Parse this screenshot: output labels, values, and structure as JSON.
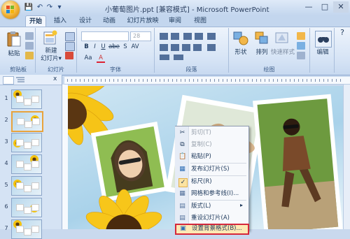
{
  "window": {
    "title": "小葡萄图片.ppt [兼容模式] - Microsoft PowerPoint",
    "controls": {
      "minimize": "—",
      "maximize": "□",
      "close": "✕"
    }
  },
  "qat": {
    "save": "💾",
    "undo": "↶",
    "redo": "↷",
    "more": "▾"
  },
  "tabs": [
    "开始",
    "插入",
    "设计",
    "动画",
    "幻灯片放映",
    "审阅",
    "视图"
  ],
  "ribbon": {
    "clipboard": {
      "label": "剪贴板",
      "paste": "粘贴"
    },
    "slides": {
      "label": "幻灯片",
      "new_slide_line1": "新建",
      "new_slide_line2": "幻灯片▾"
    },
    "font": {
      "label": "字体",
      "size_value": "28",
      "bold": "B",
      "italic": "I",
      "underline": "U",
      "strike": "abe",
      "shadow": "S",
      "spacing": "AV",
      "case": "Aa",
      "color": "A"
    },
    "paragraph": {
      "label": "段落"
    },
    "drawing": {
      "label": "绘图",
      "shape": "形状",
      "arrange": "排列",
      "quick_style": "快速样式"
    },
    "editing": {
      "label": "",
      "edit": "编辑"
    }
  },
  "slides_panel": {
    "numbers": [
      "1",
      "2",
      "3",
      "4",
      "5",
      "6",
      "7"
    ],
    "selected_index": 1,
    "close": "x"
  },
  "context_menu": {
    "items": [
      {
        "label": "剪切(T)",
        "icon": "✂",
        "disabled": true
      },
      {
        "label": "复制(C)",
        "icon": "⧉",
        "disabled": true
      },
      {
        "label": "粘贴(P)",
        "icon": "📋",
        "disabled": false
      },
      {
        "label": "发布幻灯片(S)",
        "icon": "▦",
        "disabled": false
      },
      {
        "label": "标尺(R)",
        "icon": "✓",
        "disabled": false
      },
      {
        "label": "网格和参考线(I)...",
        "icon": "▦",
        "disabled": false
      },
      {
        "label": "版式(L)",
        "icon": "▤",
        "disabled": false,
        "submenu": "▸"
      },
      {
        "label": "重设幻灯片(A)",
        "icon": "▤",
        "disabled": false
      },
      {
        "label": "设置背景格式(B)...",
        "icon": "▣",
        "disabled": false,
        "highlighted": true
      }
    ]
  },
  "colors": {
    "accent": "#e8a33c",
    "highlight_border": "#d6283b",
    "ribbon": "#d5e3f5"
  }
}
